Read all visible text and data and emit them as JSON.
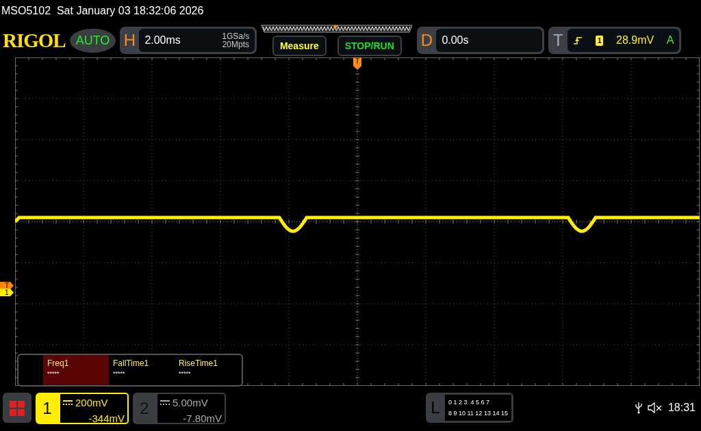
{
  "header": {
    "model": "MSO5102",
    "datetime": "Sat January 03 18:32:06 2026"
  },
  "toolbar": {
    "logo": "RIGOL",
    "mode": "AUTO",
    "horizontal": {
      "label": "H",
      "timebase": "2.00ms",
      "sample_rate": "1GSa/s",
      "memory_depth": "20Mpts"
    },
    "buttons": [
      {
        "label": "Measure",
        "color": "#ffff33"
      },
      {
        "label": "STOP/RUN",
        "color": "#22dd22"
      }
    ],
    "delay": {
      "label": "D",
      "value": "0.00s"
    },
    "trigger": {
      "label": "T",
      "source": "1",
      "level": "28.9mV",
      "mode": "A"
    }
  },
  "screen": {
    "trigger_position_marker": "T",
    "side_markers": [
      {
        "label": "T",
        "color": "#ff8800"
      },
      {
        "label": "1",
        "color": "#ffee00"
      }
    ]
  },
  "measurements": [
    {
      "name": "Freq1",
      "value": "*****",
      "selected": true
    },
    {
      "name": "FallTime1",
      "value": "*****",
      "selected": false
    },
    {
      "name": "RiseTime1",
      "value": "*****",
      "selected": false
    }
  ],
  "channels": [
    {
      "number": "1",
      "scale": "200mV",
      "offset": "-344mV",
      "selected": true
    },
    {
      "number": "2",
      "scale": "5.00mV",
      "offset": "-7.80mV",
      "selected": false
    }
  ],
  "logic": {
    "label": "L",
    "rows": [
      "0 1 2 3  4 5 6 7",
      "8 9 10 11 12 13 14 15"
    ]
  },
  "status": {
    "time": "18:31"
  }
}
